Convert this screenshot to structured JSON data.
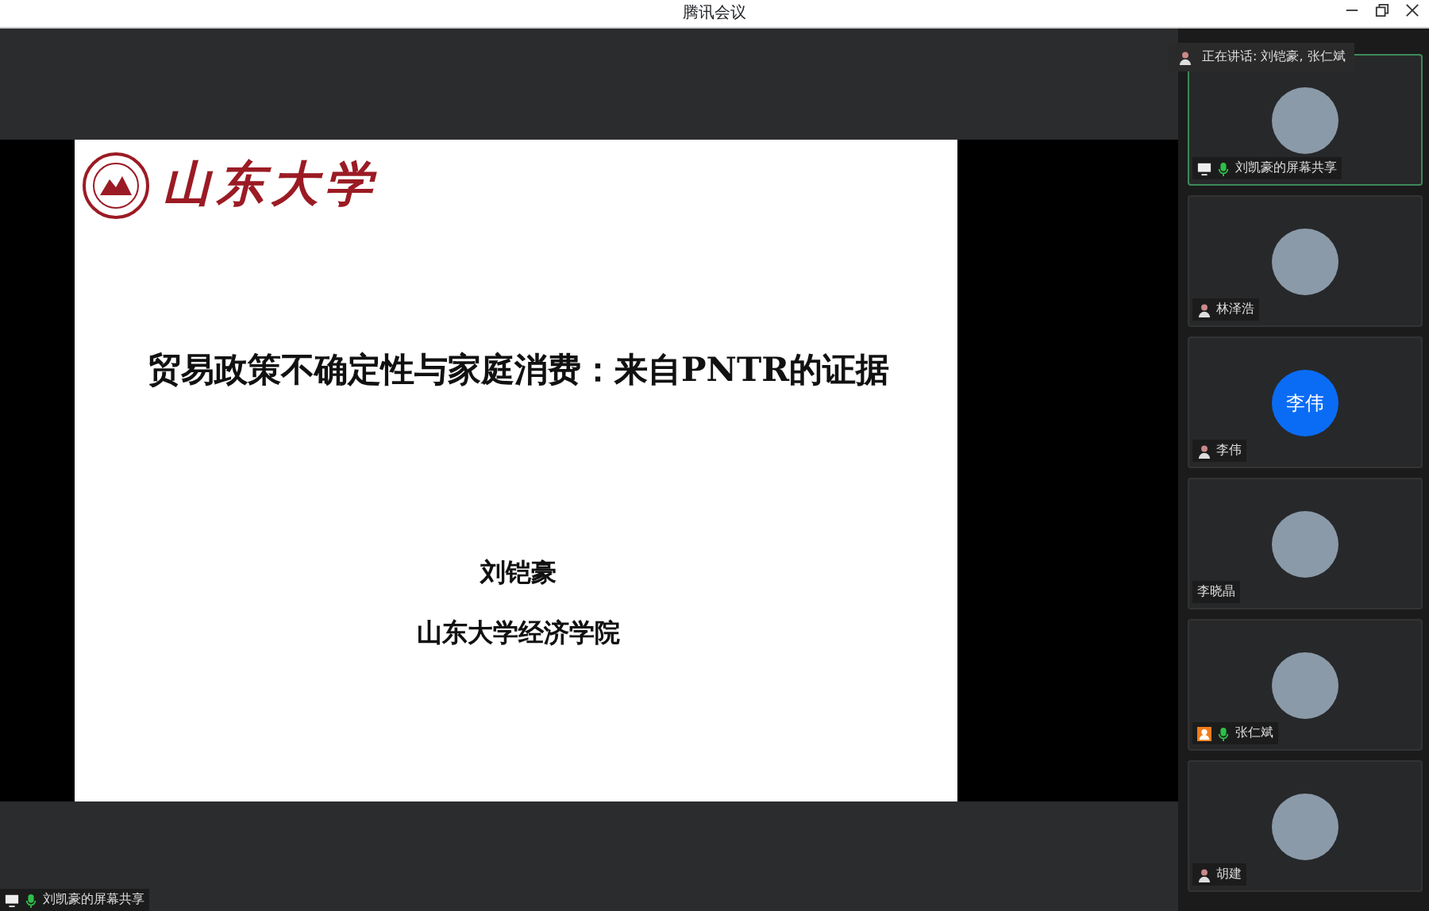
{
  "window": {
    "title": "腾讯会议"
  },
  "slide": {
    "logo_text": "山东大学",
    "title": "贸易政策不确定性与家庭消费：来自**PNTR**的证据",
    "author": "刘铠豪",
    "affiliation": "山东大学经济学院"
  },
  "share_label": {
    "text": "刘凯豪的屏幕共享",
    "icons": [
      {
        "kind": "screen"
      },
      {
        "kind": "mic"
      }
    ]
  },
  "speaking": {
    "text": "正在讲话: 刘铠豪, 张仁斌"
  },
  "participants": [
    {
      "name": "刘凯豪的屏幕共享",
      "avatar": {
        "kind": "photo"
      },
      "active": true,
      "icons": [
        {
          "kind": "screen"
        },
        {
          "kind": "mic"
        }
      ]
    },
    {
      "name": "林泽浩",
      "avatar": {
        "kind": "photo"
      },
      "active": false,
      "icons": [
        {
          "kind": "user"
        }
      ]
    },
    {
      "name": "李伟",
      "avatar": {
        "kind": "initials",
        "initials": "李伟"
      },
      "active": false,
      "icons": [
        {
          "kind": "user"
        }
      ]
    },
    {
      "name": "李晓晶",
      "avatar": {
        "kind": "photo"
      },
      "active": false
    },
    {
      "name": "张仁斌",
      "avatar": {
        "kind": "photo"
      },
      "active": false,
      "icons": [
        {
          "kind": "host"
        },
        {
          "kind": "mic"
        }
      ]
    },
    {
      "name": "胡建",
      "avatar": {
        "kind": "photo"
      },
      "active": false,
      "icons": [
        {
          "kind": "user"
        }
      ]
    }
  ]
}
